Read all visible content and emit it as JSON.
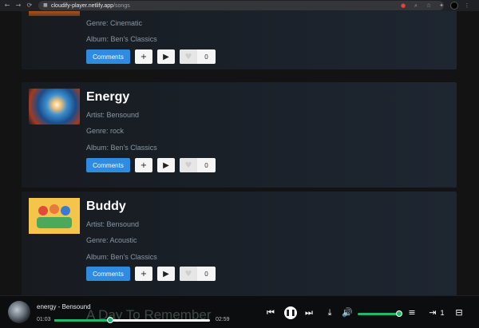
{
  "browser": {
    "url_domain": "cloudify-player.netlify.app",
    "url_path": "/songs"
  },
  "songs": [
    {
      "title": "",
      "artist": "",
      "genre": "Genre: Cinematic",
      "album": "Album: Ben's Classics",
      "comments_label": "Comments",
      "likes": "0"
    },
    {
      "title": "Energy",
      "artist": "Artist: Bensound",
      "genre": "Genre: rock",
      "album": "Album: Ben's Classics",
      "comments_label": "Comments",
      "likes": "0"
    },
    {
      "title": "Buddy",
      "artist": "Artist: Bensound",
      "genre": "Genre: Acoustic",
      "album": "Album: Ben's Classics",
      "comments_label": "Comments",
      "likes": "0"
    }
  ],
  "player": {
    "track_label": "energy - Bensound",
    "ghost_text": "A Day To Remember",
    "current_time": "01:03",
    "duration": "02:59",
    "progress_fraction": 0.36,
    "volume_fraction": 1.0,
    "queue_count": "1"
  },
  "colors": {
    "accent_green": "#1db96f",
    "comments_blue": "#2e8be0"
  },
  "icons": {
    "add": "plus-icon",
    "play": "play-icon",
    "like": "heart-icon"
  }
}
